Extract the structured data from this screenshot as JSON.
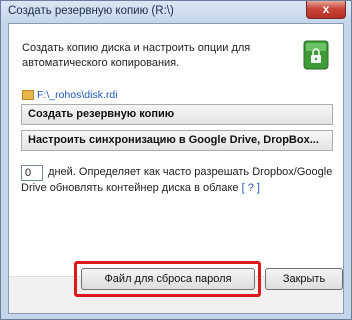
{
  "window": {
    "title": "Создать резервную копию (R:\\)",
    "close_glyph": "x"
  },
  "main": {
    "description": "Создать копию диска и настроить опции для автоматического копирования.",
    "drive_icon": "green-lock-drive-icon",
    "path": "F:\\_rohos\\disk.rdi",
    "create_backup_label": "Создать резервную копию",
    "sync_label": "Настроить синхронизацию в Google Drive, DropBox...",
    "days_value": "0",
    "days_text": "дней. Определяет как часто разрешать Dropbox/Google Drive обновлять контейнер диска в облаке",
    "help_link": "[ ? ]"
  },
  "footer": {
    "reset_file_label": "Файл для сброса пароля",
    "close_label": "Закрыть"
  },
  "colors": {
    "highlight": "#e0191f",
    "link": "#1f58b8"
  }
}
